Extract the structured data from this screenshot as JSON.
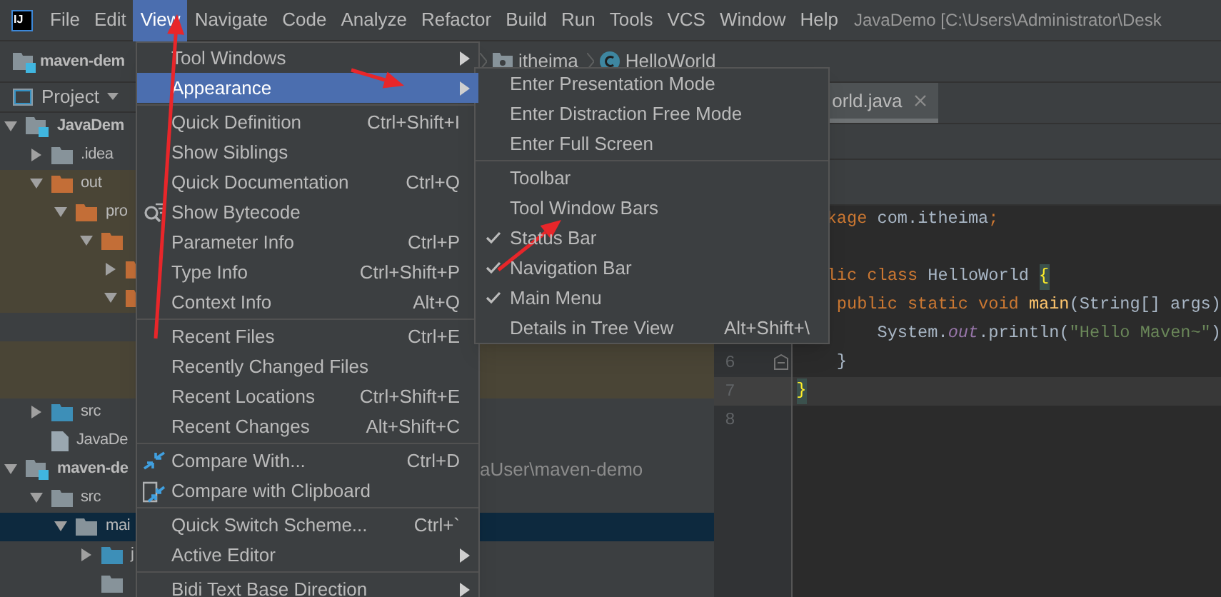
{
  "app_logo": "IJ",
  "menu_bar": [
    {
      "label": "File",
      "selected": false
    },
    {
      "label": "Edit",
      "selected": false
    },
    {
      "label": "View",
      "selected": true
    },
    {
      "label": "Navigate",
      "selected": false
    },
    {
      "label": "Code",
      "selected": false
    },
    {
      "label": "Analyze",
      "selected": false
    },
    {
      "label": "Refactor",
      "selected": false
    },
    {
      "label": "Build",
      "selected": false
    },
    {
      "label": "Run",
      "selected": false
    },
    {
      "label": "Tools",
      "selected": false
    },
    {
      "label": "VCS",
      "selected": false
    },
    {
      "label": "Window",
      "selected": false
    },
    {
      "label": "Help",
      "selected": false
    }
  ],
  "window_title": "JavaDemo [C:\\Users\\Administrator\\Desk",
  "navigation_bar": {
    "project": "maven-dem",
    "path": [
      "itheima",
      "HelloWorld"
    ]
  },
  "project_panel": {
    "title": "Project",
    "tree": [
      {
        "label": "JavaDem",
        "kind": "module",
        "bold": true,
        "expanded": true,
        "excluded": false,
        "selected": false,
        "children": [
          {
            "label": ".idea",
            "kind": "folder",
            "expanded": false,
            "excluded": false,
            "selected": false
          },
          {
            "label": "out",
            "kind": "excluded-folder",
            "expanded": true,
            "excluded": true,
            "selected": false,
            "children": [
              {
                "label": "pro",
                "kind": "excluded-folder",
                "expanded": true,
                "excluded": true,
                "selected": false,
                "children": [
                  {
                    "kind": "excluded-folder",
                    "expanded": true,
                    "excluded": true,
                    "selected": false,
                    "children": [
                      {
                        "kind": "excluded-folder",
                        "expanded": false,
                        "excluded": true,
                        "selected": false
                      },
                      {
                        "kind": "excluded-folder",
                        "expanded": true,
                        "excluded": true,
                        "selected": false,
                        "children": [
                          {
                            "excluded": false,
                            "selected": false
                          },
                          {
                            "excluded": true,
                            "selected": false
                          },
                          {
                            "excluded": true,
                            "selected": false
                          }
                        ]
                      }
                    ]
                  }
                ]
              }
            ]
          },
          {
            "label": "src",
            "kind": "source-folder",
            "expanded": false,
            "excluded": false,
            "selected": false
          },
          {
            "label": "JavaDe",
            "kind": "file",
            "excluded": false,
            "selected": false
          }
        ]
      },
      {
        "label": "maven-de",
        "kind": "module",
        "bold": true,
        "expanded": true,
        "excluded": false,
        "selected": false,
        "path": "aUser\\maven-demo",
        "children": [
          {
            "label": "src",
            "kind": "folder",
            "expanded": true,
            "excluded": false,
            "selected": false,
            "children": [
              {
                "label": "mai",
                "kind": "folder",
                "expanded": true,
                "selected": true,
                "children": [
                  {
                    "label": "j",
                    "kind": "source-folder",
                    "expanded": false,
                    "excluded": false,
                    "selected": false
                  },
                  {
                    "kind": "resource-folder",
                    "excluded": false,
                    "selected": false
                  }
                ]
              }
            ]
          }
        ]
      }
    ]
  },
  "editor": {
    "tabs": [
      {
        "label": "orld.java",
        "selected": true
      }
    ],
    "lines": [
      {
        "current": false,
        "tokens": [
          {
            "kind": "keyword",
            "text": "   kage "
          },
          {
            "kind": "plain",
            "text": "com.itheima"
          },
          {
            "kind": "keyword",
            "text": ";"
          }
        ]
      },
      {
        "current": false
      },
      {
        "current": false,
        "tokens": [
          {
            "kind": "keyword",
            "text": "   lic class "
          },
          {
            "kind": "plain",
            "text": "HelloWorld "
          },
          {
            "kind": "brace-match",
            "text": "{"
          }
        ]
      },
      {
        "current": false,
        "tokens": [
          {
            "kind": "keyword",
            "text": "    public static void "
          },
          {
            "kind": "method",
            "text": "main"
          },
          {
            "kind": "plain",
            "text": "(String[] args)"
          }
        ]
      },
      {
        "current": false,
        "tokens": [
          {
            "kind": "plain",
            "text": "        System."
          },
          {
            "kind": "field",
            "text": "out"
          },
          {
            "kind": "plain",
            "text": ".println("
          },
          {
            "kind": "string",
            "text": "\"Hello Maven~\""
          },
          {
            "kind": "plain",
            "text": ")"
          }
        ]
      },
      {
        "number": "6",
        "fold": true,
        "current": false,
        "tokens": [
          {
            "kind": "plain",
            "text": "    }"
          }
        ]
      },
      {
        "number": "7",
        "current": true,
        "tokens": [
          {
            "kind": "brace-match",
            "text": "}"
          }
        ]
      },
      {
        "number": "8",
        "current": false
      }
    ]
  },
  "view_menu": {
    "items": [
      {
        "kind": "item",
        "label": "Tool Windows",
        "submenu": true,
        "selected": false
      },
      {
        "kind": "item",
        "label": "Appearance",
        "submenu": true,
        "selected": true
      },
      {
        "kind": "separator"
      },
      {
        "kind": "item",
        "label": "Quick Definition",
        "shortcut": "Ctrl+Shift+I",
        "submenu": false,
        "selected": false
      },
      {
        "kind": "item",
        "label": "Show Siblings",
        "submenu": false,
        "selected": false
      },
      {
        "kind": "item",
        "label": "Quick Documentation",
        "shortcut": "Ctrl+Q",
        "submenu": false,
        "selected": false
      },
      {
        "kind": "item",
        "label": "Show Bytecode",
        "submenu": false,
        "selected": false
      },
      {
        "kind": "item",
        "label": "Parameter Info",
        "shortcut": "Ctrl+P",
        "submenu": false,
        "selected": false
      },
      {
        "kind": "item",
        "label": "Type Info",
        "shortcut": "Ctrl+Shift+P",
        "submenu": false,
        "selected": false
      },
      {
        "kind": "item",
        "label": "Context Info",
        "shortcut": "Alt+Q",
        "submenu": false,
        "selected": false
      },
      {
        "kind": "separator"
      },
      {
        "kind": "item",
        "label": "Recent Files",
        "shortcut": "Ctrl+E",
        "submenu": false,
        "selected": false
      },
      {
        "kind": "item",
        "label": "Recently Changed Files",
        "submenu": false,
        "selected": false
      },
      {
        "kind": "item",
        "label": "Recent Locations",
        "shortcut": "Ctrl+Shift+E",
        "submenu": false,
        "selected": false
      },
      {
        "kind": "item",
        "label": "Recent Changes",
        "shortcut": "Alt+Shift+C",
        "submenu": false,
        "selected": false
      },
      {
        "kind": "separator"
      },
      {
        "kind": "item",
        "label": "Compare With...",
        "shortcut": "Ctrl+D",
        "submenu": false,
        "selected": false
      },
      {
        "kind": "item",
        "label": "Compare with Clipboard",
        "submenu": false,
        "selected": false
      },
      {
        "kind": "separator"
      },
      {
        "kind": "item",
        "label": "Quick Switch Scheme...",
        "shortcut": "Ctrl+`",
        "submenu": false,
        "selected": false
      },
      {
        "kind": "item",
        "label": "Active Editor",
        "submenu": true,
        "selected": false
      },
      {
        "kind": "separator"
      },
      {
        "kind": "item",
        "label": "Bidi Text Base Direction",
        "submenu": true,
        "selected": false
      }
    ]
  },
  "appearance_submenu": {
    "items": [
      {
        "kind": "item",
        "label": "Enter Presentation Mode",
        "checked": false
      },
      {
        "kind": "item",
        "label": "Enter Distraction Free Mode",
        "checked": false
      },
      {
        "kind": "item",
        "label": "Enter Full Screen",
        "checked": false
      },
      {
        "kind": "separator"
      },
      {
        "kind": "item",
        "label": "Toolbar",
        "checked": false
      },
      {
        "kind": "item",
        "label": "Tool Window Bars",
        "checked": false
      },
      {
        "kind": "item",
        "label": "Status Bar",
        "checked": true
      },
      {
        "kind": "item",
        "label": "Navigation Bar",
        "checked": true
      },
      {
        "kind": "item",
        "label": "Main Menu",
        "checked": true
      },
      {
        "kind": "item",
        "label": "Details in Tree View",
        "shortcut": "Alt+Shift+\\",
        "checked": false
      }
    ]
  }
}
